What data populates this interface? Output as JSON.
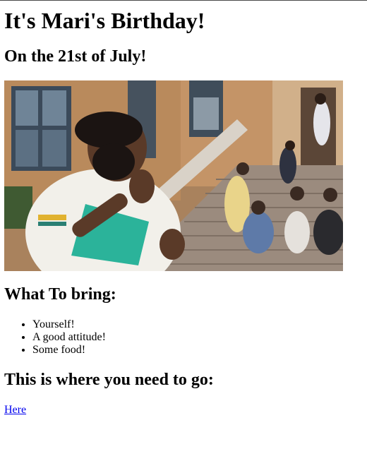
{
  "page": {
    "title": "It's Mari's Birthday!",
    "date_heading": "On the 21st of July!"
  },
  "bring": {
    "heading": "What To bring:",
    "items": [
      "Yourself!",
      "A good attitude!",
      "Some food!"
    ]
  },
  "directions": {
    "heading": "This is where you need to go:",
    "link_label": "Here"
  },
  "colors": {
    "link": "#0000ee",
    "text": "#000000",
    "background": "#ffffff"
  }
}
